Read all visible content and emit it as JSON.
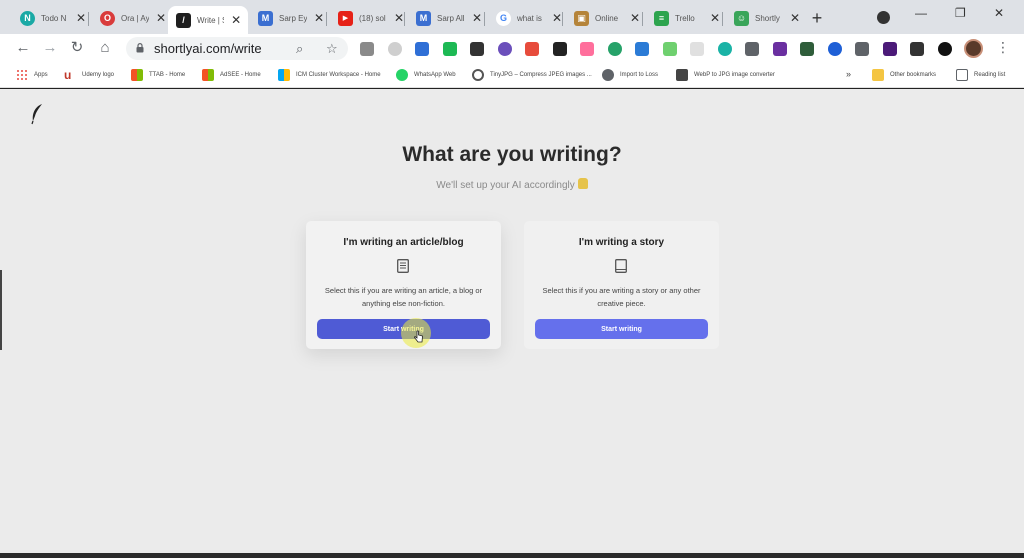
{
  "tabs": [
    {
      "title": "Todo N",
      "fav_color": "#1aa9a5",
      "fav_char": "N"
    },
    {
      "title": "Ora | Ay",
      "fav_color": "#d93c3c",
      "fav_char": "O"
    },
    {
      "title": "Write | S",
      "fav_color": "#1f1f1f",
      "fav_char": "/"
    },
    {
      "title": "Sarp Ey",
      "fav_color": "#3b6fd1",
      "fav_char": "M"
    },
    {
      "title": "(18) sol",
      "fav_color": "#e62117",
      "fav_char": "▶"
    },
    {
      "title": "Sarp All",
      "fav_color": "#3b6fd1",
      "fav_char": "M"
    },
    {
      "title": "what is",
      "fav_color": "#ffffff",
      "fav_char": "G"
    },
    {
      "title": "Online",
      "fav_color": "#b5843a",
      "fav_char": "▣"
    },
    {
      "title": "Trello",
      "fav_color": "#2da44e",
      "fav_char": "≡"
    },
    {
      "title": "Shortly",
      "fav_color": "#3aa55a",
      "fav_char": "☺"
    }
  ],
  "window": {
    "minimize": "—",
    "restore": "❐",
    "close": "✕",
    "new_tab": "+"
  },
  "toolbar": {
    "back": "←",
    "forward": "→",
    "reload": "↻",
    "home": "⌂",
    "url": "shortlyai.com/write",
    "menu": "⋮"
  },
  "extensions": [
    "#8a8a8a",
    "#cfcfcf",
    "#2f6fd6",
    "#1db954",
    "#333333",
    "#6b4fbb",
    "#e74c3c",
    "#222222",
    "#ff6f9c",
    "#26a269",
    "#2b7bd6",
    "#6fd06f",
    "#e0e0e0",
    "#1ab3a6",
    "#5f6368",
    "#6a2fa0",
    "#2f5d3a",
    "#1e5fd6",
    "#5f6368",
    "#4b1a78",
    "#333333",
    "#111111"
  ],
  "bookmarks": [
    {
      "label": "Apps",
      "color": "#e8453c"
    },
    {
      "label": "Udemy logo",
      "color": "#c0392b"
    },
    {
      "label": "TTAB - Home",
      "color": "#f35325"
    },
    {
      "label": "AdSEE - Home",
      "color": "#f35325"
    },
    {
      "label": "ICM Cluster Workspace - Home",
      "color": "#f35325"
    },
    {
      "label": "WhatsApp Web",
      "color": "#25d366"
    },
    {
      "label": "TinyJPG – Compress JPEG images ...",
      "color": "#555555"
    },
    {
      "label": "Import to Loss",
      "color": "#5f6368"
    },
    {
      "label": "WebP to JPG image converter",
      "color": "#444444"
    },
    {
      "label": "Other bookmarks",
      "color": "#f4c542"
    },
    {
      "label": "Reading list",
      "color": "#5f6368"
    }
  ],
  "page": {
    "headline": "What are you writing?",
    "subhead": "We'll set up your AI accordingly",
    "accent": "#5e69d9",
    "cards": [
      {
        "title": "I'm writing an article/blog",
        "desc": "Select this if you are writing an article, a blog or anything else non-fiction.",
        "button": "Start writing",
        "button_color": "#4f5bd5"
      },
      {
        "title": "I'm writing a story",
        "desc": "Select this if you are writing a story or any other creative piece.",
        "button": "Start writing",
        "button_color": "#6570ec"
      }
    ]
  }
}
